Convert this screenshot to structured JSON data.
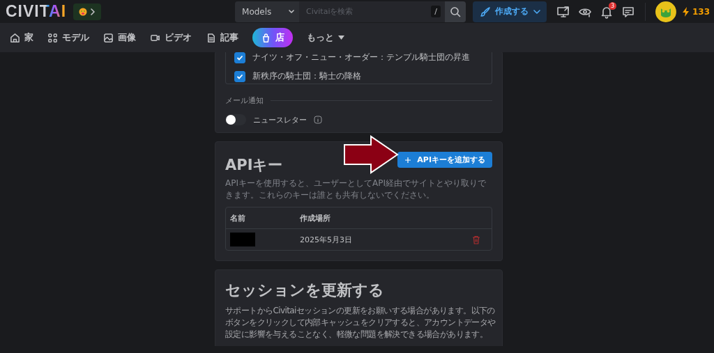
{
  "header": {
    "logo": "CIVITAI",
    "search": {
      "category": "Models",
      "placeholder": "Civitaiを検索",
      "shortcut": "/"
    },
    "create_button": "作成する",
    "notification_count": "3",
    "buzz": "133"
  },
  "nav": [
    {
      "kind": "home",
      "label": "家"
    },
    {
      "kind": "models",
      "label": "モデル"
    },
    {
      "kind": "images",
      "label": "画像"
    },
    {
      "kind": "video",
      "label": "ビデオ"
    },
    {
      "kind": "articles",
      "label": "記事"
    },
    {
      "kind": "shop",
      "label": "店"
    },
    {
      "kind": "more",
      "label": "もっと"
    }
  ],
  "notifications": {
    "checkboxes": [
      {
        "label": "ナイツ・オフ・ニュー・オーダー：テンプル騎士団の昇進",
        "checked": true
      },
      {
        "label": "新秩序の騎士団：騎士の降格",
        "checked": true
      }
    ],
    "email_title": "メール通知",
    "toggles": [
      {
        "label": "ニュースレター",
        "on": false
      }
    ]
  },
  "api_keys": {
    "title": "APIキー",
    "add_button": "APIキーを追加する",
    "description": "APIキーを使用すると、ユーザーとしてAPI経由でサイトとやり取りできます。これらのキーは誰とも共有しないでください。",
    "columns": [
      "名前",
      "作成場所"
    ],
    "rows": [
      {
        "created": "2025年5月3日"
      }
    ]
  },
  "session": {
    "title": "セッションを更新する",
    "description": "サポートからCivitaiセッションの更新をお願いする場合があります。以下のボタンをクリックして内部キャッシュをクリアすると、アカウントデータや設定に影響を与えることなく、軽微な問題を解決できる場合があります。"
  }
}
